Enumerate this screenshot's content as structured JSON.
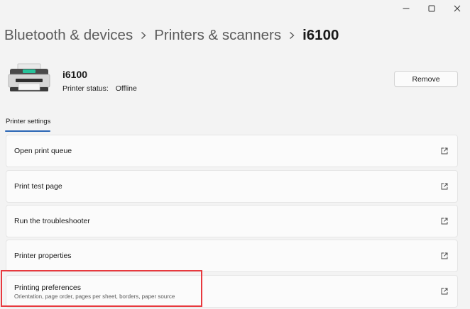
{
  "window": {
    "controls": {
      "minimize_icon": "minimize-icon",
      "maximize_icon": "maximize-icon",
      "close_icon": "close-icon"
    }
  },
  "breadcrumb": {
    "items": [
      "Bluetooth & devices",
      "Printers & scanners"
    ],
    "current": "i6100",
    "separator_icon": "chevron-right-icon"
  },
  "printer": {
    "name": "i6100",
    "status_label": "Printer status:",
    "status_value": "Offline",
    "icon": "printer-icon",
    "remove_label": "Remove"
  },
  "tabs": {
    "active": "Printer settings"
  },
  "settings_rows": [
    {
      "label": "Open print queue",
      "icon": "open-external-icon"
    },
    {
      "label": "Print test page",
      "icon": "open-external-icon"
    },
    {
      "label": "Run the troubleshooter",
      "icon": "open-external-icon"
    },
    {
      "label": "Printer properties",
      "icon": "open-external-icon"
    },
    {
      "label": "Printing preferences",
      "description": "Orientation, page order, pages per sheet, borders, paper source",
      "icon": "open-external-icon"
    }
  ],
  "colors": {
    "accent": "#2b66b5",
    "highlight": "#e8393e",
    "background": "#f3f3f3",
    "card": "#fbfbfb"
  }
}
